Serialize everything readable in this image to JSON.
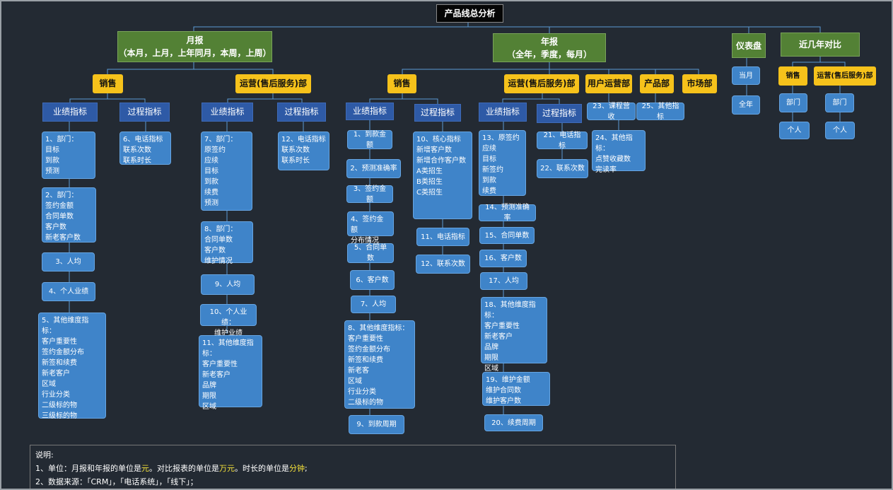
{
  "title": "产品线总分析",
  "monthly": {
    "title": "月报",
    "subtitle": "（本月，上月，上年同月，本周，上周）"
  },
  "yearly": {
    "title": "年报",
    "subtitle": "（全年，季度，每月）"
  },
  "dashboard": "仪表盘",
  "recent_compare": "近几年对比",
  "labels": {
    "sales": "销售",
    "ops": "运营(售后服务)部",
    "user_ops": "用户运营部",
    "product": "产品部",
    "market": "市场部",
    "perf": "业绩指标",
    "process": "过程指标",
    "dept": "部门",
    "person": "个人",
    "cur_month": "当月",
    "full_year": "全年"
  },
  "m_sales_perf": [
    "1、部门：\n目标\n到款\n预测",
    "2、部门：\n签约金额\n合同单数\n客户数\n新老客户数",
    "3、人均",
    "4、个人业绩",
    "5、其他维度指标：\n客户重要性\n签约金额分布\n新签和续费\n新老客户\n区域\n行业分类\n二级标的物\n三级标的物"
  ],
  "m_sales_proc": [
    "6、电话指标\n联系次数\n联系时长"
  ],
  "m_ops_perf": [
    "7、部门：\n原签约\n应续\n目标\n到款\n续费\n预测",
    "8、部门：\n合同单数\n客户数\n维护情况",
    "9、人均",
    "10、个人业绩：\n维护业绩",
    "11、其他维度指标：\n客户重要性\n新老客户\n品牌\n期限\n区域"
  ],
  "m_ops_proc": [
    "12、电话指标\n联系次数\n联系时长"
  ],
  "y_sales_perf": [
    "1、到款金额",
    "2、预测准确率",
    "3、签约金额",
    "4、签约金额\n分布情况",
    "5、合同单数",
    "6、客户数",
    "7、人均",
    "8、其他维度指标：\n客户重要性\n签约金额分布\n新签和续费\n新老客\n区域\n行业分类\n二级标的物",
    "9、到款周期"
  ],
  "y_sales_proc": [
    "10、核心指标\n新增客户数\n新增合作客户数\nA类招生\nB类招生\nC类招生",
    "11、电话指标",
    "12、联系次数"
  ],
  "y_ops_perf": [
    "13、原签约\n应续\n目标\n新签约\n到款\n续费",
    "14、预测准确率",
    "15、合同单数",
    "16、客户数",
    "17、人均",
    "18、其他维度指标：\n客户重要性\n新老客户\n品牌\n期限\n区域",
    "19、维护金额\n维护合同数\n维护客户数",
    "20、续费周期"
  ],
  "y_ops_proc": [
    "21、电话指标",
    "22、联系次数"
  ],
  "y_user_ops": [
    "23、课程营收"
  ],
  "y_product": [
    "25、其他指标"
  ],
  "y_user_ops_sub": [
    "24、其他指标：\n点赞收藏数\n完读率"
  ],
  "notes": {
    "heading": "说明:",
    "line1_pre": "1、单位：月报和年报的单位是",
    "line1_unit1": "元",
    "line1_mid": "。对比报表的单位是",
    "line1_unit2": "万元",
    "line1_mid2": "。时长的单位是",
    "line1_unit3": "分钟",
    "line1_post": ";",
    "line2": "2、数据来源：「CRM」，「电话系统」，「线下」；"
  },
  "colors": {
    "background": "#232a33",
    "green": "#538135",
    "yellow": "#f6c21b",
    "navy": "#2e5aa6",
    "blue": "#3f84c9",
    "highlight": "#f4e13a"
  }
}
